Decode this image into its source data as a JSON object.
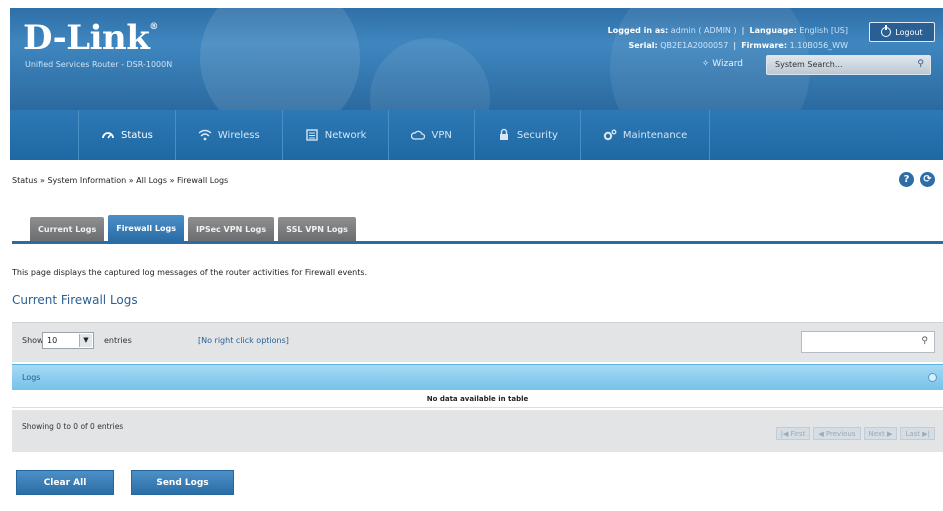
{
  "header": {
    "brand": "D-Link",
    "brand_mark": "®",
    "tagline": "Unified Services Router - DSR-1000N",
    "logged_in_label": "Logged in as:",
    "logged_in_value": "admin ( ADMIN )",
    "language_label": "Language:",
    "language_value": "English [US]",
    "serial_label": "Serial:",
    "serial_value": "QB2E1A2000057",
    "firmware_label": "Firmware:",
    "firmware_value": "1.10B056_WW",
    "logout_label": "Logout",
    "wizard_label": "Wizard",
    "search_placeholder": "System Search..."
  },
  "nav": {
    "items": [
      {
        "label": "Status",
        "icon": "dashboard-icon"
      },
      {
        "label": "Wireless",
        "icon": "wifi-icon"
      },
      {
        "label": "Network",
        "icon": "network-icon"
      },
      {
        "label": "VPN",
        "icon": "cloud-icon"
      },
      {
        "label": "Security",
        "icon": "lock-icon"
      },
      {
        "label": "Maintenance",
        "icon": "gears-icon"
      }
    ],
    "active": "Status"
  },
  "breadcrumb": "Status  »  System Information  »  All Logs  »  Firewall Logs",
  "tabs": [
    "Current Logs",
    "Firewall Logs",
    "IPSec VPN Logs",
    "SSL VPN Logs"
  ],
  "active_tab": "Firewall Logs",
  "description": "This page displays the captured log messages of the router activities for Firewall events.",
  "section_title": "Current Firewall Logs",
  "table": {
    "show_label": "Show",
    "show_value": "10",
    "entries_label": "entries",
    "right_click": "[No right click options]",
    "column_header": "Logs",
    "empty_message": "No data available in table",
    "showing_text": "Showing 0 to 0 of 0 entries",
    "pager": {
      "first": "First",
      "previous": "Previous",
      "next": "Next",
      "last": "Last"
    }
  },
  "actions": {
    "clear_all": "Clear All",
    "send_logs": "Send Logs"
  },
  "colors": {
    "header_blue": "#3f86bf",
    "nav_blue": "#1f68a3",
    "tab_active": "#2a6da6",
    "table_header": "#75c2ea"
  }
}
